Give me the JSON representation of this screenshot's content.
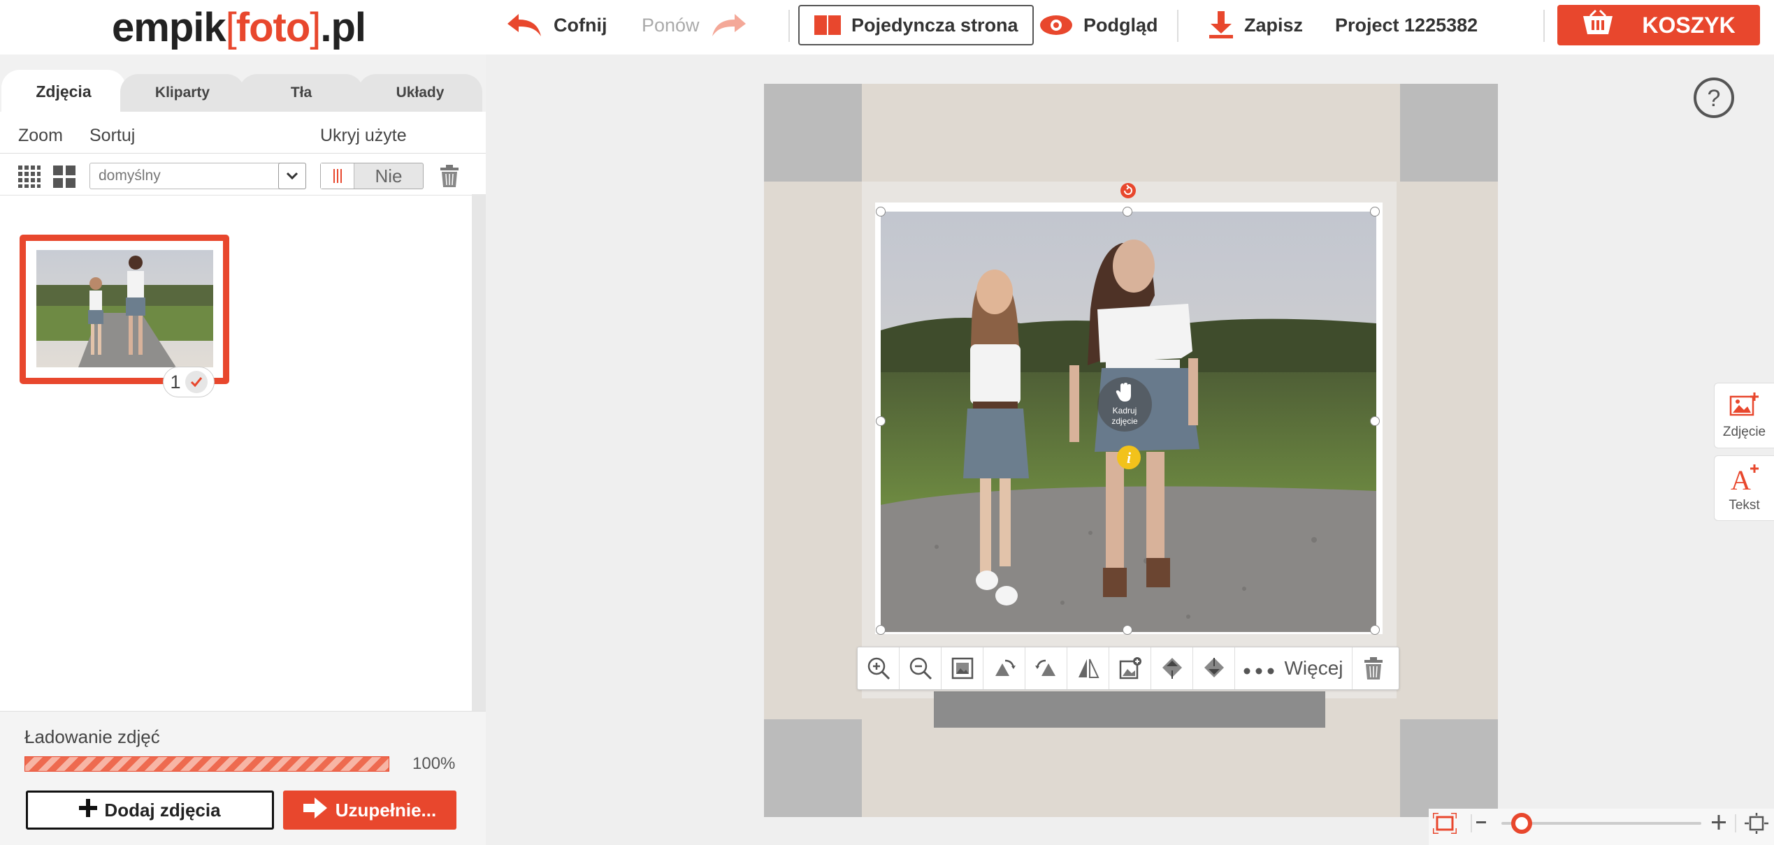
{
  "header": {
    "logo": {
      "left": "empik",
      "bracket_open": "[",
      "brand": "foto",
      "bracket_close": "]",
      "right": ".pl"
    },
    "undo_label": "Cofnij",
    "redo_label": "Ponów",
    "single_page_label": "Pojedyncza strona",
    "preview_label": "Podgląd",
    "save_label": "Zapisz",
    "project_name": "Project 1225382",
    "cart_label": "KOSZYK"
  },
  "sidebar": {
    "tabs": [
      {
        "label": "Zdjęcia",
        "active": true
      },
      {
        "label": "Kliparty",
        "active": false
      },
      {
        "label": "Tła",
        "active": false
      },
      {
        "label": "Układy",
        "active": false
      }
    ],
    "zoom_label": "Zoom",
    "sort_label": "Sortuj",
    "hide_used_label": "Ukryj użyte",
    "sort_value": "domyślny",
    "hide_used_value": "Nie",
    "photos": [
      {
        "usage_count": "1",
        "selected": true
      }
    ],
    "upload": {
      "title": "Ładowanie zdjęć",
      "progress_text": "100%",
      "progress": 1.0,
      "add_button": "Dodaj zdjęcia",
      "fill_button": "Uzupełnie..."
    }
  },
  "canvas": {
    "crop_hint": "Kadruj zdjęcie",
    "toolbar": {
      "tools": [
        "zoom-in-icon",
        "zoom-out-icon",
        "fit-photo-icon",
        "rotate-left-icon",
        "rotate-right-icon",
        "flip-icon",
        "replace-photo-icon",
        "bring-forward-icon",
        "send-backward-icon"
      ],
      "more_label": "Więcej"
    }
  },
  "right_panel": {
    "add_photo_label": "Zdjęcie",
    "add_text_label": "Tekst"
  },
  "zoom": {
    "level": 0.1
  },
  "colors": {
    "accent": "#e8472d",
    "canvas_bg": "#efefef",
    "page_bg": "#dfd9d1"
  }
}
